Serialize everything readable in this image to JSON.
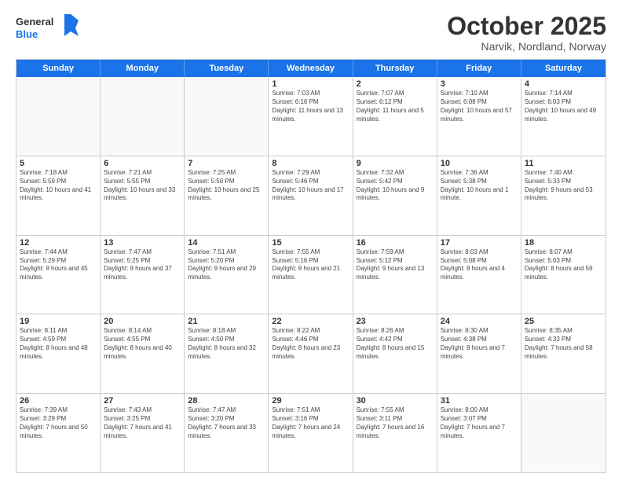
{
  "logo": {
    "line1": "General",
    "line2": "Blue"
  },
  "title": "October 2025",
  "location": "Narvik, Nordland, Norway",
  "days_of_week": [
    "Sunday",
    "Monday",
    "Tuesday",
    "Wednesday",
    "Thursday",
    "Friday",
    "Saturday"
  ],
  "weeks": [
    [
      {
        "day": "",
        "sunrise": "",
        "sunset": "",
        "daylight": "",
        "empty": true
      },
      {
        "day": "",
        "sunrise": "",
        "sunset": "",
        "daylight": "",
        "empty": true
      },
      {
        "day": "",
        "sunrise": "",
        "sunset": "",
        "daylight": "",
        "empty": true
      },
      {
        "day": "1",
        "sunrise": "Sunrise: 7:03 AM",
        "sunset": "Sunset: 6:16 PM",
        "daylight": "Daylight: 11 hours and 13 minutes.",
        "empty": false
      },
      {
        "day": "2",
        "sunrise": "Sunrise: 7:07 AM",
        "sunset": "Sunset: 6:12 PM",
        "daylight": "Daylight: 11 hours and 5 minutes.",
        "empty": false
      },
      {
        "day": "3",
        "sunrise": "Sunrise: 7:10 AM",
        "sunset": "Sunset: 6:08 PM",
        "daylight": "Daylight: 10 hours and 57 minutes.",
        "empty": false
      },
      {
        "day": "4",
        "sunrise": "Sunrise: 7:14 AM",
        "sunset": "Sunset: 6:03 PM",
        "daylight": "Daylight: 10 hours and 49 minutes.",
        "empty": false
      }
    ],
    [
      {
        "day": "5",
        "sunrise": "Sunrise: 7:18 AM",
        "sunset": "Sunset: 5:59 PM",
        "daylight": "Daylight: 10 hours and 41 minutes.",
        "empty": false
      },
      {
        "day": "6",
        "sunrise": "Sunrise: 7:21 AM",
        "sunset": "Sunset: 5:55 PM",
        "daylight": "Daylight: 10 hours and 33 minutes.",
        "empty": false
      },
      {
        "day": "7",
        "sunrise": "Sunrise: 7:25 AM",
        "sunset": "Sunset: 5:50 PM",
        "daylight": "Daylight: 10 hours and 25 minutes.",
        "empty": false
      },
      {
        "day": "8",
        "sunrise": "Sunrise: 7:29 AM",
        "sunset": "Sunset: 5:46 PM",
        "daylight": "Daylight: 10 hours and 17 minutes.",
        "empty": false
      },
      {
        "day": "9",
        "sunrise": "Sunrise: 7:32 AM",
        "sunset": "Sunset: 5:42 PM",
        "daylight": "Daylight: 10 hours and 9 minutes.",
        "empty": false
      },
      {
        "day": "10",
        "sunrise": "Sunrise: 7:36 AM",
        "sunset": "Sunset: 5:38 PM",
        "daylight": "Daylight: 10 hours and 1 minute.",
        "empty": false
      },
      {
        "day": "11",
        "sunrise": "Sunrise: 7:40 AM",
        "sunset": "Sunset: 5:33 PM",
        "daylight": "Daylight: 9 hours and 53 minutes.",
        "empty": false
      }
    ],
    [
      {
        "day": "12",
        "sunrise": "Sunrise: 7:44 AM",
        "sunset": "Sunset: 5:29 PM",
        "daylight": "Daylight: 9 hours and 45 minutes.",
        "empty": false
      },
      {
        "day": "13",
        "sunrise": "Sunrise: 7:47 AM",
        "sunset": "Sunset: 5:25 PM",
        "daylight": "Daylight: 9 hours and 37 minutes.",
        "empty": false
      },
      {
        "day": "14",
        "sunrise": "Sunrise: 7:51 AM",
        "sunset": "Sunset: 5:20 PM",
        "daylight": "Daylight: 9 hours and 29 minutes.",
        "empty": false
      },
      {
        "day": "15",
        "sunrise": "Sunrise: 7:55 AM",
        "sunset": "Sunset: 5:16 PM",
        "daylight": "Daylight: 9 hours and 21 minutes.",
        "empty": false
      },
      {
        "day": "16",
        "sunrise": "Sunrise: 7:59 AM",
        "sunset": "Sunset: 5:12 PM",
        "daylight": "Daylight: 9 hours and 13 minutes.",
        "empty": false
      },
      {
        "day": "17",
        "sunrise": "Sunrise: 8:03 AM",
        "sunset": "Sunset: 5:08 PM",
        "daylight": "Daylight: 9 hours and 4 minutes.",
        "empty": false
      },
      {
        "day": "18",
        "sunrise": "Sunrise: 8:07 AM",
        "sunset": "Sunset: 5:03 PM",
        "daylight": "Daylight: 8 hours and 56 minutes.",
        "empty": false
      }
    ],
    [
      {
        "day": "19",
        "sunrise": "Sunrise: 8:11 AM",
        "sunset": "Sunset: 4:59 PM",
        "daylight": "Daylight: 8 hours and 48 minutes.",
        "empty": false
      },
      {
        "day": "20",
        "sunrise": "Sunrise: 8:14 AM",
        "sunset": "Sunset: 4:55 PM",
        "daylight": "Daylight: 8 hours and 40 minutes.",
        "empty": false
      },
      {
        "day": "21",
        "sunrise": "Sunrise: 8:18 AM",
        "sunset": "Sunset: 4:50 PM",
        "daylight": "Daylight: 8 hours and 32 minutes.",
        "empty": false
      },
      {
        "day": "22",
        "sunrise": "Sunrise: 8:22 AM",
        "sunset": "Sunset: 4:46 PM",
        "daylight": "Daylight: 8 hours and 23 minutes.",
        "empty": false
      },
      {
        "day": "23",
        "sunrise": "Sunrise: 8:26 AM",
        "sunset": "Sunset: 4:42 PM",
        "daylight": "Daylight: 8 hours and 15 minutes.",
        "empty": false
      },
      {
        "day": "24",
        "sunrise": "Sunrise: 8:30 AM",
        "sunset": "Sunset: 4:38 PM",
        "daylight": "Daylight: 8 hours and 7 minutes.",
        "empty": false
      },
      {
        "day": "25",
        "sunrise": "Sunrise: 8:35 AM",
        "sunset": "Sunset: 4:33 PM",
        "daylight": "Daylight: 7 hours and 58 minutes.",
        "empty": false
      }
    ],
    [
      {
        "day": "26",
        "sunrise": "Sunrise: 7:39 AM",
        "sunset": "Sunset: 3:29 PM",
        "daylight": "Daylight: 7 hours and 50 minutes.",
        "empty": false
      },
      {
        "day": "27",
        "sunrise": "Sunrise: 7:43 AM",
        "sunset": "Sunset: 3:25 PM",
        "daylight": "Daylight: 7 hours and 41 minutes.",
        "empty": false
      },
      {
        "day": "28",
        "sunrise": "Sunrise: 7:47 AM",
        "sunset": "Sunset: 3:20 PM",
        "daylight": "Daylight: 7 hours and 33 minutes.",
        "empty": false
      },
      {
        "day": "29",
        "sunrise": "Sunrise: 7:51 AM",
        "sunset": "Sunset: 3:16 PM",
        "daylight": "Daylight: 7 hours and 24 minutes.",
        "empty": false
      },
      {
        "day": "30",
        "sunrise": "Sunrise: 7:55 AM",
        "sunset": "Sunset: 3:11 PM",
        "daylight": "Daylight: 7 hours and 16 minutes.",
        "empty": false
      },
      {
        "day": "31",
        "sunrise": "Sunrise: 8:00 AM",
        "sunset": "Sunset: 3:07 PM",
        "daylight": "Daylight: 7 hours and 7 minutes.",
        "empty": false
      },
      {
        "day": "",
        "sunrise": "",
        "sunset": "",
        "daylight": "",
        "empty": true
      }
    ]
  ]
}
